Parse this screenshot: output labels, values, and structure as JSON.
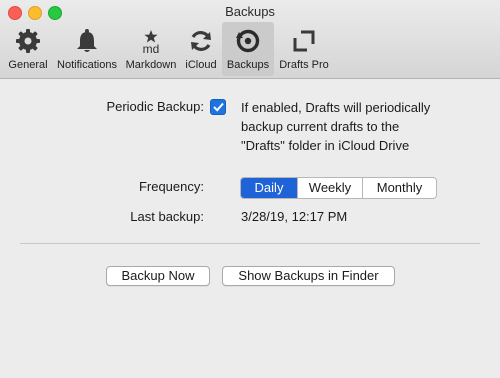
{
  "window": {
    "title": "Backups"
  },
  "toolbar": {
    "items": [
      {
        "label": "General",
        "icon": "gear-icon"
      },
      {
        "label": "Notifications",
        "icon": "bell-icon"
      },
      {
        "label": "Markdown",
        "icon": "markdown-icon",
        "icon_text": "md"
      },
      {
        "label": "iCloud",
        "icon": "sync-icon"
      },
      {
        "label": "Backups",
        "icon": "backup-icon",
        "selected": true
      },
      {
        "label": "Drafts Pro",
        "icon": "expand-icon"
      }
    ]
  },
  "periodic_backup": {
    "label": "Periodic Backup:",
    "checked": true,
    "description": "If enabled, Drafts will periodically backup current drafts to the \"Drafts\" folder in iCloud Drive"
  },
  "frequency": {
    "label": "Frequency:",
    "options": [
      "Daily",
      "Weekly",
      "Monthly"
    ],
    "selected": "Daily"
  },
  "last_backup": {
    "label": "Last backup:",
    "value": "3/28/19, 12:17 PM"
  },
  "buttons": {
    "backup_now": "Backup Now",
    "show_in_finder": "Show Backups in Finder"
  },
  "colors": {
    "accent": "#1f63d8",
    "checkbox": "#1f73e0",
    "close": "#fc5f57",
    "minimize": "#fdbc2e",
    "maximize": "#28c840"
  }
}
